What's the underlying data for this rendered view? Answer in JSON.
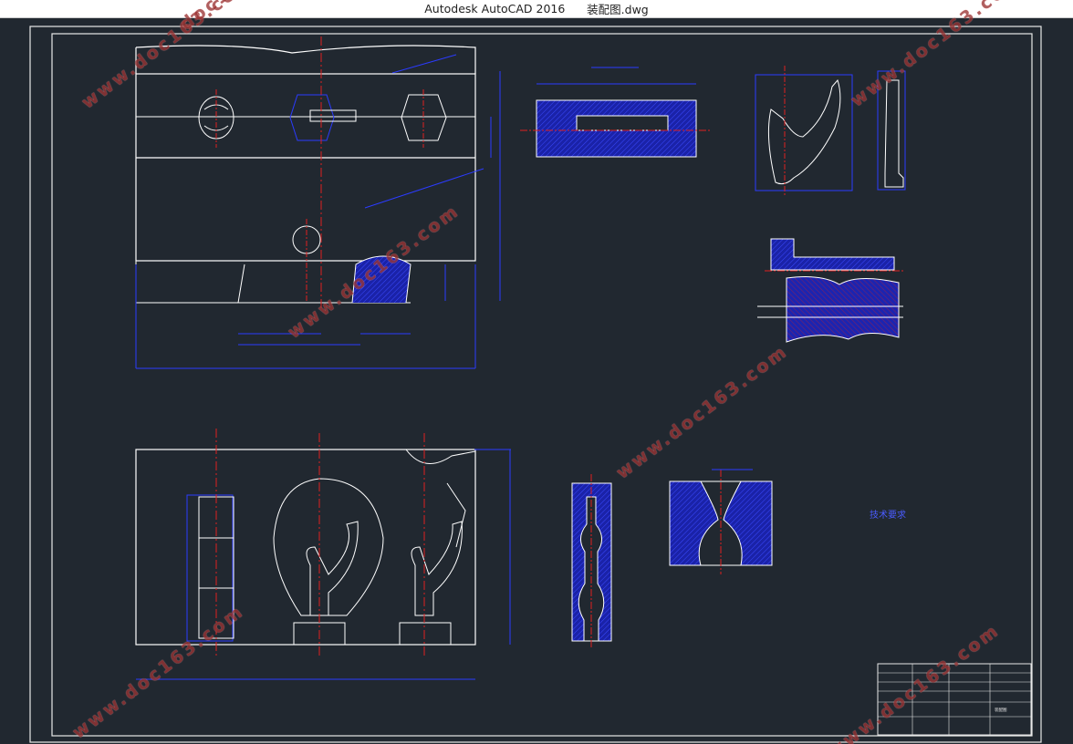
{
  "window": {
    "app_title": "Autodesk AutoCAD 2016",
    "file_name": "装配图.dwg"
  },
  "watermark": {
    "text": "www.doc163.com",
    "partial_text": "doc163.c",
    "color": "#a03838"
  },
  "drawing": {
    "background": "#212830",
    "line_color": "#ffffff",
    "dimension_color": "#2b3bff",
    "centerline_color": "#e02020",
    "hatch_color": "#1a22a8",
    "tech_requirements_title": "技术要求"
  },
  "title_block": {
    "header": "装配图"
  }
}
